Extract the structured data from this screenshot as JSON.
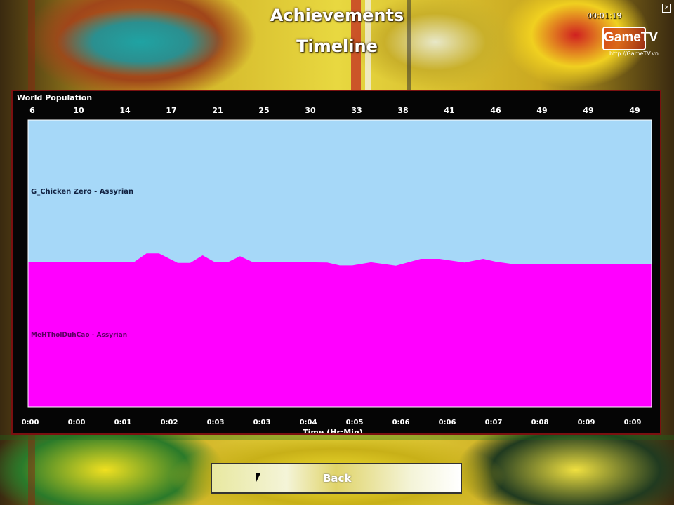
{
  "header": {
    "title": "Achievements",
    "subtitle": "Timeline",
    "clock": "00:01:19"
  },
  "logo": {
    "text": "GameTV",
    "sub": "http://GameTV.vn"
  },
  "panel": {
    "title": "World Population"
  },
  "chart_data": {
    "type": "area",
    "title": "World Population",
    "xlabel": "Time (Hr:Min)",
    "ylabel": "",
    "top_ticks": [
      "6",
      "10",
      "14",
      "17",
      "21",
      "25",
      "30",
      "33",
      "38",
      "41",
      "46",
      "49",
      "49",
      "49"
    ],
    "x_ticks": [
      "0:00",
      "0:00",
      "0:01",
      "0:02",
      "0:03",
      "0:03",
      "0:04",
      "0:05",
      "0:06",
      "0:06",
      "0:07",
      "0:08",
      "0:09",
      "0:09"
    ],
    "ylim": [
      0,
      100
    ],
    "x": [
      0,
      0.08,
      0.17,
      0.19,
      0.21,
      0.24,
      0.26,
      0.28,
      0.3,
      0.32,
      0.34,
      0.36,
      0.38,
      0.42,
      0.48,
      0.5,
      0.52,
      0.55,
      0.59,
      0.63,
      0.66,
      0.7,
      0.73,
      0.75,
      0.78,
      0.85,
      1.0
    ],
    "series": [
      {
        "name": "G_Chicken Zero - Assyrian",
        "color": "#a6d8f8",
        "values": [
          50,
          50,
          50,
          50,
          50,
          50,
          50,
          50,
          50,
          50,
          50,
          50,
          50,
          50,
          50,
          50,
          50,
          50,
          50,
          50,
          50,
          50,
          50,
          50,
          50,
          50,
          50
        ]
      },
      {
        "name": "MeHTholDuhCao - Assyrian",
        "color": "#ff00ff",
        "values": [
          50.5,
          50.5,
          50.5,
          53.5,
          53.5,
          50.2,
          50.2,
          52.8,
          50.4,
          50.4,
          52.5,
          50.5,
          50.5,
          50.5,
          50.3,
          49.3,
          49.3,
          50.4,
          49.2,
          51.6,
          51.6,
          50.3,
          51.6,
          50.6,
          49.7,
          49.7,
          49.7
        ]
      }
    ],
    "legend": "inline-left"
  },
  "footer": {
    "back_label": "Back"
  },
  "colors": {
    "top_series": "#a6d8f8",
    "bottom_series": "#ff00ff",
    "panel_bg": "#050505"
  }
}
